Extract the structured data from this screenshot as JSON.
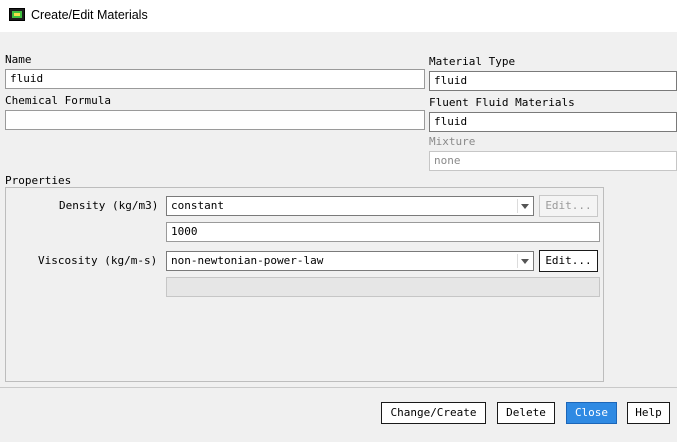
{
  "window": {
    "title": "Create/Edit Materials",
    "icon": "fluent-app-icon"
  },
  "name": {
    "label": "Name",
    "value": "fluid"
  },
  "chemical_formula": {
    "label": "Chemical Formula",
    "value": ""
  },
  "material_type": {
    "label": "Material Type",
    "value": "fluid"
  },
  "fluent_fluid_materials": {
    "label": "Fluent Fluid Materials",
    "value": "fluid"
  },
  "mixture": {
    "label": "Mixture",
    "value": "none",
    "enabled": false
  },
  "properties": {
    "label": "Properties",
    "density": {
      "label": "Density (kg/m3)",
      "method": "constant",
      "value": "1000",
      "edit_label": "Edit...",
      "edit_enabled": false
    },
    "viscosity": {
      "label": "Viscosity (kg/m-s)",
      "method": "non-newtonian-power-law",
      "value": "",
      "edit_label": "Edit...",
      "edit_enabled": true
    }
  },
  "buttons": {
    "change_create": "Change/Create",
    "delete": "Delete",
    "close": "Close",
    "help": "Help"
  },
  "colors": {
    "accent": "#2f8ae3",
    "background": "#f0f0f0"
  }
}
